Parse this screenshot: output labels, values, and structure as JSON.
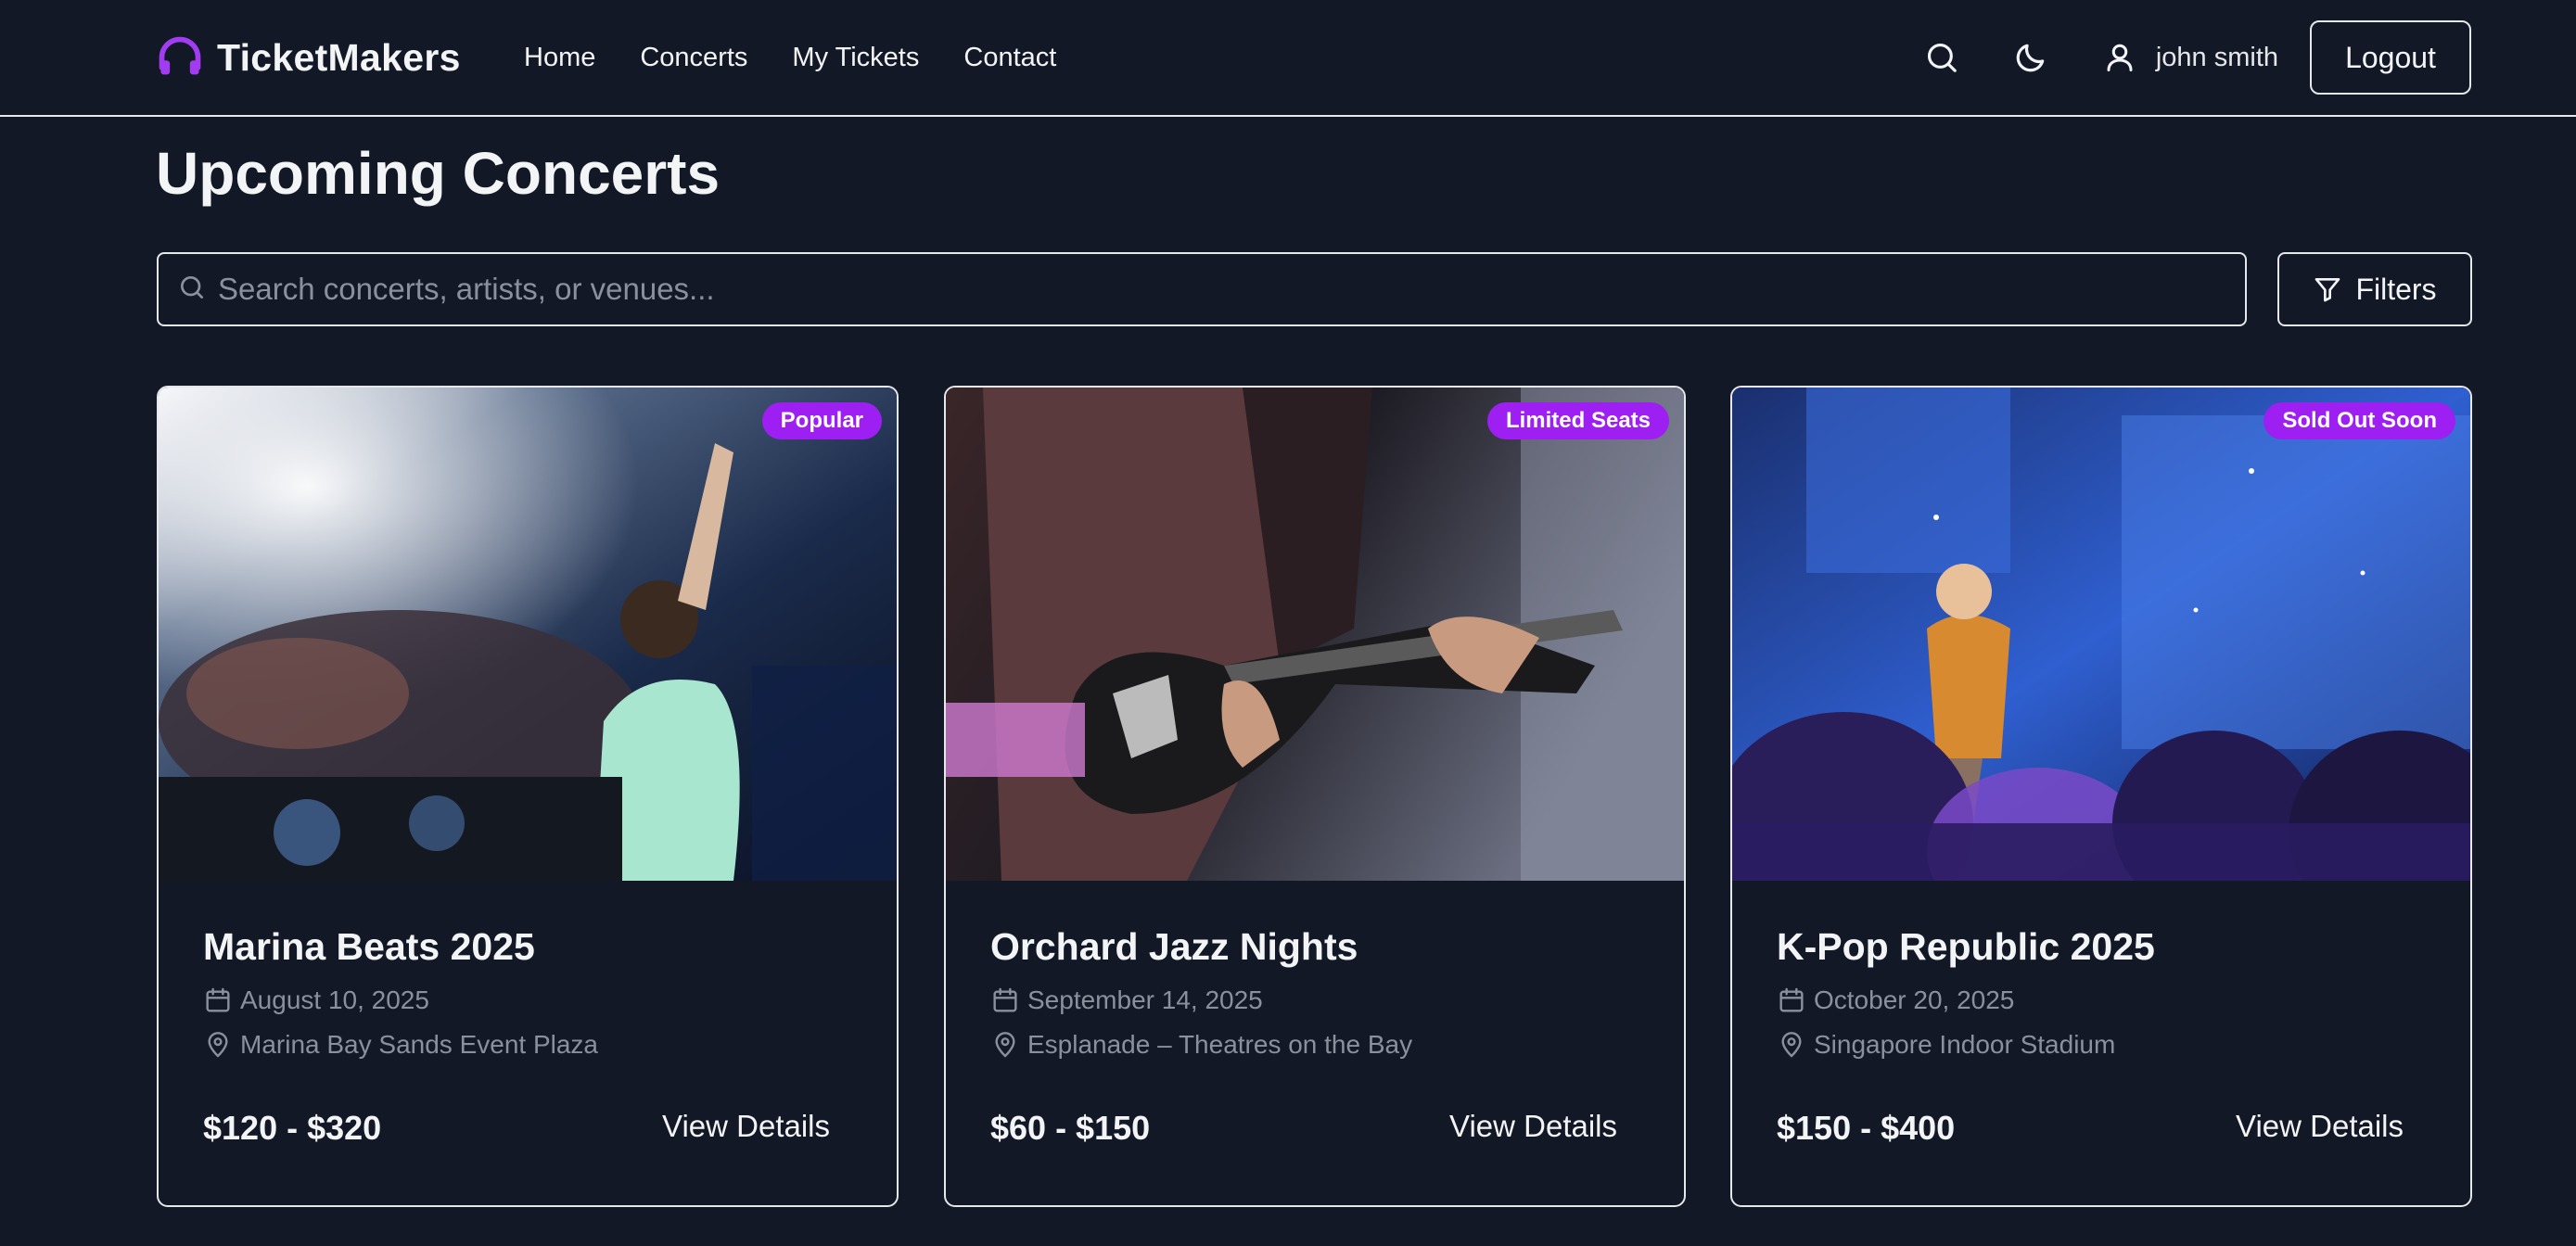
{
  "header": {
    "brand": "TicketMakers",
    "nav": [
      "Home",
      "Concerts",
      "My Tickets",
      "Contact"
    ],
    "username": "john smith",
    "logout_label": "Logout"
  },
  "main": {
    "title": "Upcoming Concerts",
    "search": {
      "placeholder": "Search concerts, artists, or venues...",
      "value": ""
    },
    "filters_label": "Filters"
  },
  "concerts": [
    {
      "badge": "Popular",
      "title": "Marina Beats 2025",
      "date": "August 10, 2025",
      "venue": "Marina Bay Sands Event Plaza",
      "price": "$120 - $320",
      "cta": "View Details"
    },
    {
      "badge": "Limited Seats",
      "title": "Orchard Jazz Nights",
      "date": "September 14, 2025",
      "venue": "Esplanade – Theatres on the Bay",
      "price": "$60 - $150",
      "cta": "View Details"
    },
    {
      "badge": "Sold Out Soon",
      "title": "K-Pop Republic 2025",
      "date": "October 20, 2025",
      "venue": "Singapore Indoor Stadium",
      "price": "$150 - $400",
      "cta": "View Details"
    }
  ],
  "colors": {
    "background": "#131826",
    "accent": "#9d1ff2",
    "border": "#e5e7eb",
    "muted": "#8a909c"
  },
  "icons": [
    "headphones-icon",
    "search-icon",
    "moon-icon",
    "user-icon",
    "filter-icon",
    "calendar-icon",
    "map-pin-icon"
  ]
}
